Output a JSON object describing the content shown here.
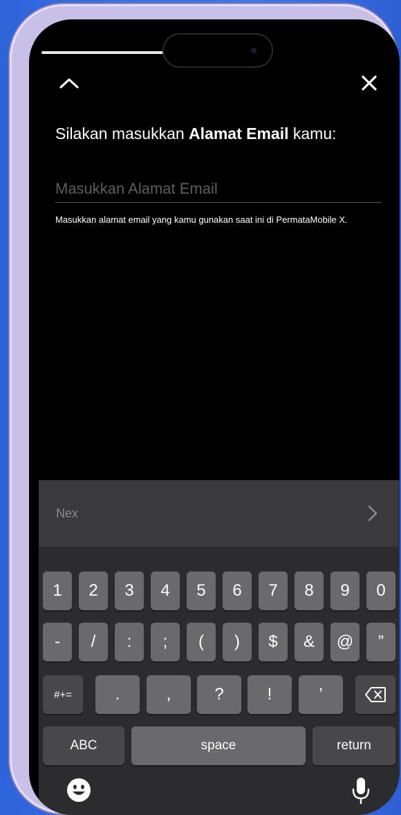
{
  "header": {
    "heading_prefix": "Silakan masukkan ",
    "heading_bold": "Alamat Email",
    "heading_suffix": " kamu:"
  },
  "email": {
    "placeholder": "Masukkan Alamat Email",
    "value": "",
    "helper": "Masukkan alamat email yang kamu gunakan saat ini di PermataMobile X."
  },
  "keyboard": {
    "next_label": "Nex",
    "row1": [
      "1",
      "2",
      "3",
      "4",
      "5",
      "6",
      "7",
      "8",
      "9",
      "0"
    ],
    "row2": [
      "-",
      "/",
      ":",
      ";",
      "(",
      ")",
      "$",
      "&",
      "@",
      "”"
    ],
    "row3": [
      ".",
      ",",
      "?",
      "!",
      "’"
    ],
    "mode_key": "#+=",
    "abc_key": "ABC",
    "space_key": "space",
    "return_key": "return"
  },
  "icons": {
    "up": "chevron-up-icon",
    "close": "close-icon",
    "next": "chevron-right-icon",
    "backspace": "backspace-icon",
    "emoji": "emoji-icon",
    "mic": "microphone-icon"
  }
}
